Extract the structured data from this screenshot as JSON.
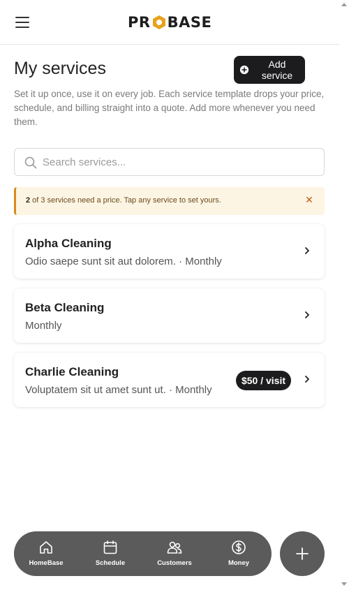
{
  "header": {
    "logo_left": "PR",
    "logo_right": "BASE"
  },
  "page": {
    "title": "My services",
    "add_button_label": "Add service",
    "description": "Set it up once, use it on every job. Each service template drops your price, schedule, and billing straight into a quote. Add more whenever you need them."
  },
  "search": {
    "placeholder": "Search services..."
  },
  "alert": {
    "count": "2",
    "text": " of 3 services need a price. Tap any service to set yours.",
    "close_glyph": "✕"
  },
  "services": [
    {
      "name": "Alpha Cleaning",
      "subtitle": "Odio saepe sunt sit aut dolorem. · Monthly",
      "price": ""
    },
    {
      "name": "Beta Cleaning",
      "subtitle": "Monthly",
      "price": ""
    },
    {
      "name": "Charlie Cleaning",
      "subtitle": "Voluptatem sit ut amet sunt ut. · Monthly",
      "price": "$50 / visit"
    }
  ],
  "nav": {
    "items": [
      {
        "label": "HomeBase",
        "icon": "home-icon"
      },
      {
        "label": "Schedule",
        "icon": "calendar-icon"
      },
      {
        "label": "Customers",
        "icon": "users-icon"
      },
      {
        "label": "Money",
        "icon": "dollar-icon"
      }
    ]
  },
  "colors": {
    "accent": "#e8a21a",
    "dark": "#1c1c1e",
    "nav_bg": "#5b5b5b",
    "alert_bg": "#fdf5e3",
    "alert_border": "#d88a1c"
  }
}
